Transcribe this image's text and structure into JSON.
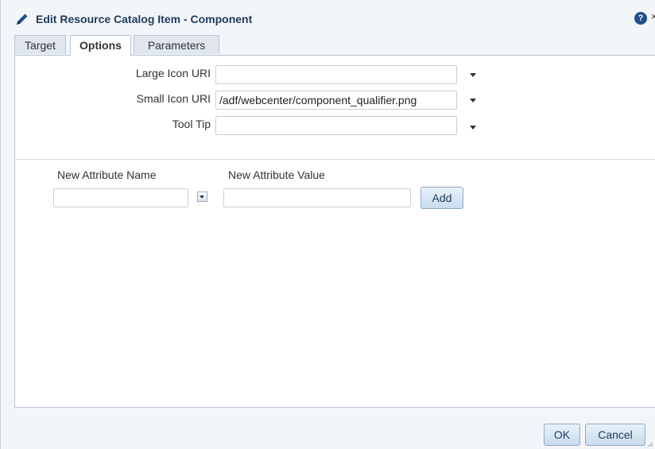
{
  "dialog": {
    "title": "Edit Resource Catalog Item - Component",
    "help_glyph": "?",
    "close_glyph": "×"
  },
  "tabs": [
    {
      "label": "Target",
      "selected": false
    },
    {
      "label": "Options",
      "selected": true
    },
    {
      "label": "Parameters",
      "selected": false
    }
  ],
  "options": {
    "large_icon": {
      "label": "Large Icon URI",
      "value": ""
    },
    "small_icon": {
      "label": "Small Icon URI",
      "value": "/adf/webcenter/component_qualifier.png"
    },
    "tool_tip": {
      "label": "Tool Tip",
      "value": ""
    }
  },
  "attributes": {
    "name_label": "New Attribute Name",
    "value_label": "New Attribute Value",
    "name_value": "",
    "value_value": "",
    "add_label": "Add"
  },
  "footer": {
    "ok_label": "OK",
    "cancel_label": "Cancel"
  },
  "icons": [
    "pencil-icon",
    "help-icon",
    "close-icon",
    "chevron-down-icon",
    "resize-grip-icon"
  ]
}
